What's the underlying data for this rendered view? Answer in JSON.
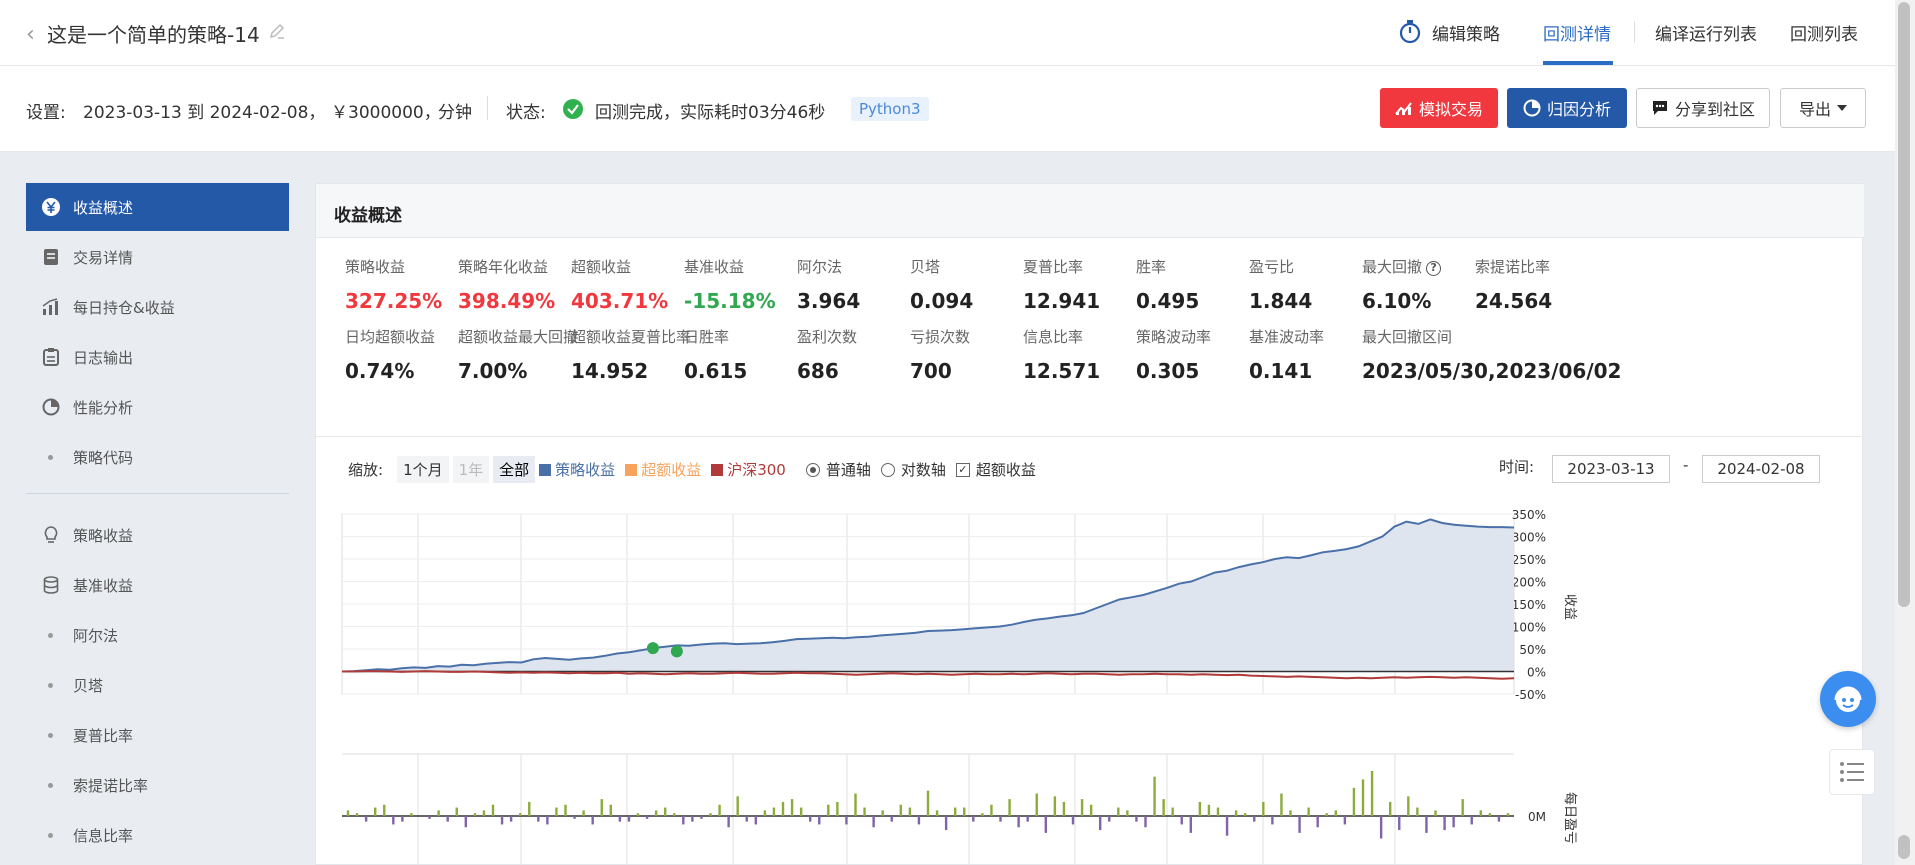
{
  "header": {
    "back_glyph": "‹",
    "title": "这是一个简单的策略-14",
    "nav": [
      "编辑策略",
      "回测详情",
      "编译运行列表",
      "回测列表"
    ],
    "active_nav": "回测详情"
  },
  "settings": {
    "label": "设置:",
    "range": "2023-03-13 到 2024-02-08，",
    "capital": "￥3000000，",
    "freq": "分钟",
    "status_label": "状态:",
    "status_text": "回测完成，实际耗时03分46秒",
    "lang_badge": "Python3",
    "buttons": {
      "sim": "模拟交易",
      "attr": "归因分析",
      "share": "分享到社区",
      "export": "导出"
    }
  },
  "sidebar": {
    "items": [
      {
        "label": "收益概述",
        "icon": "yen-icon",
        "active": true
      },
      {
        "label": "交易详情",
        "icon": "document-icon"
      },
      {
        "label": "每日持仓&收益",
        "icon": "bar-chart-icon"
      },
      {
        "label": "日志输出",
        "icon": "clipboard-icon"
      },
      {
        "label": "性能分析",
        "icon": "pie-icon"
      },
      {
        "label": "策略代码",
        "icon": "dot"
      },
      {
        "label": "策略收益",
        "icon": "bulb-icon"
      },
      {
        "label": "基准收益",
        "icon": "database-icon"
      },
      {
        "label": "阿尔法",
        "icon": "dot"
      },
      {
        "label": "贝塔",
        "icon": "dot"
      },
      {
        "label": "夏普比率",
        "icon": "dot"
      },
      {
        "label": "索提诺比率",
        "icon": "dot"
      },
      {
        "label": "信息比率",
        "icon": "dot"
      }
    ]
  },
  "card": {
    "title": "收益概述",
    "metrics_row1": [
      {
        "label": "策略收益",
        "value": "327.25%",
        "color": "red"
      },
      {
        "label": "策略年化收益",
        "value": "398.49%",
        "color": "red"
      },
      {
        "label": "超额收益",
        "value": "403.71%",
        "color": "red"
      },
      {
        "label": "基准收益",
        "value": "-15.18%",
        "color": "green"
      },
      {
        "label": "阿尔法",
        "value": "3.964"
      },
      {
        "label": "贝塔",
        "value": "0.094"
      },
      {
        "label": "夏普比率",
        "value": "12.941"
      },
      {
        "label": "胜率",
        "value": "0.495"
      },
      {
        "label": "盈亏比",
        "value": "1.844"
      },
      {
        "label": "最大回撤",
        "value": "6.10%",
        "help": "?"
      },
      {
        "label": "索提诺比率",
        "value": "24.564"
      }
    ],
    "metrics_row2": [
      {
        "label": "日均超额收益",
        "value": "0.74%"
      },
      {
        "label": "超额收益最大回撤",
        "value": "7.00%"
      },
      {
        "label": "超额收益夏普比率",
        "value": "14.952"
      },
      {
        "label": "日胜率",
        "value": "0.615"
      },
      {
        "label": "盈利次数",
        "value": "686"
      },
      {
        "label": "亏损次数",
        "value": "700"
      },
      {
        "label": "信息比率",
        "value": "12.571"
      },
      {
        "label": "策略波动率",
        "value": "0.305"
      },
      {
        "label": "基准波动率",
        "value": "0.141"
      },
      {
        "label": "最大回撤区间",
        "value": "2023/05/30,2023/06/02"
      }
    ]
  },
  "chart_controls": {
    "zoom_label": "缩放:",
    "zoom": [
      "1个月",
      "1年",
      "全部"
    ],
    "legend": [
      {
        "label": "策略收益",
        "color": "#4a70a8"
      },
      {
        "label": "超额收益",
        "color": "#f7a35c"
      },
      {
        "label": "沪深300",
        "color": "#b03a3a"
      }
    ],
    "axis_normal": "普通轴",
    "axis_log": "对数轴",
    "excess_check": "超额收益",
    "time_label": "时间:",
    "date_from": "2023-03-13",
    "date_to": "2024-02-08",
    "dash": "-"
  },
  "chart_data": [
    {
      "type": "area",
      "ylabel": "收益",
      "ylim": [
        -50,
        350
      ],
      "yticks": [
        "350%",
        "300%",
        "250%",
        "200%",
        "150%",
        "100%",
        "50%",
        "0%",
        "-50%"
      ],
      "grid": true,
      "series": [
        {
          "name": "策略收益",
          "color": "#4a70a8",
          "values": [
            0,
            1,
            3,
            5,
            4,
            7,
            9,
            8,
            12,
            11,
            15,
            14,
            17,
            19,
            21,
            20,
            27,
            30,
            28,
            26,
            29,
            31,
            35,
            40,
            43,
            47,
            52,
            55,
            58,
            57,
            60,
            62,
            63,
            61,
            62,
            63,
            65,
            68,
            72,
            73,
            74,
            75,
            74,
            76,
            77,
            80,
            82,
            84,
            86,
            90,
            91,
            92,
            94,
            96,
            98,
            100,
            104,
            110,
            115,
            118,
            122,
            125,
            130,
            140,
            150,
            160,
            165,
            170,
            178,
            186,
            195,
            200,
            210,
            220,
            224,
            232,
            238,
            243,
            250,
            254,
            252,
            258,
            265,
            268,
            272,
            278,
            289,
            300,
            322,
            333,
            328,
            338,
            330,
            326,
            324,
            322,
            321,
            321,
            320
          ]
        },
        {
          "name": "沪深300",
          "color": "#b03a3a",
          "values": [
            0,
            0,
            1,
            1,
            0,
            -1,
            0,
            1,
            0,
            -1,
            -1,
            0,
            -1,
            -2,
            -3,
            -2,
            -3,
            -2,
            -3,
            -4,
            -3,
            -4,
            -4,
            -3,
            -5,
            -4,
            -5,
            -6,
            -5,
            -4,
            -5,
            -5,
            -4,
            -3,
            -4,
            -5,
            -5,
            -4,
            -3,
            -4,
            -4,
            -5,
            -6,
            -7,
            -6,
            -5,
            -4,
            -5,
            -6,
            -5,
            -6,
            -7,
            -6,
            -5,
            -6,
            -6,
            -5,
            -6,
            -5,
            -4,
            -5,
            -6,
            -5,
            -5,
            -6,
            -7,
            -6,
            -6,
            -5,
            -6,
            -6,
            -7,
            -6,
            -7,
            -8,
            -7,
            -9,
            -10,
            -11,
            -12,
            -11,
            -12,
            -13,
            -14,
            -15,
            -14,
            -15,
            -14,
            -13,
            -14,
            -13,
            -12,
            -13,
            -14,
            -13,
            -14,
            -15,
            -16,
            -15
          ]
        }
      ],
      "markers": 2
    },
    {
      "type": "bar",
      "ylabel": "每日盈亏",
      "ytick": "0M",
      "values": [
        2,
        1,
        -2,
        3,
        4,
        -3,
        -2,
        1,
        0,
        -1,
        2,
        -2,
        3,
        -4,
        1,
        2,
        4,
        -3,
        -2,
        1,
        5,
        -2,
        -3,
        3,
        4,
        -1,
        2,
        -3,
        6,
        4,
        -2,
        -2,
        1,
        -1,
        2,
        3,
        1,
        -3,
        -2,
        -1,
        1,
        4,
        -4,
        7,
        -2,
        -3,
        2,
        3,
        5,
        6,
        3,
        -2,
        -3,
        4,
        5,
        -3,
        8,
        3,
        -4,
        2,
        -2,
        4,
        3,
        -3,
        9,
        2,
        -5,
        3,
        3,
        -2,
        1,
        4,
        -2,
        6,
        -4,
        -2,
        8,
        -6,
        7,
        5,
        -3,
        6,
        4,
        -5,
        -2,
        3,
        2,
        -2,
        -4,
        14,
        6,
        3,
        -3,
        -6,
        5,
        4,
        3,
        -7,
        2,
        1,
        -2,
        5,
        -3,
        8,
        2,
        -6,
        3,
        -4,
        1,
        2,
        -3,
        10,
        13,
        16,
        -8,
        5,
        -5,
        7,
        3,
        -6,
        2,
        -5,
        -4,
        6,
        -3,
        2,
        1,
        -2,
        1
      ]
    }
  ]
}
